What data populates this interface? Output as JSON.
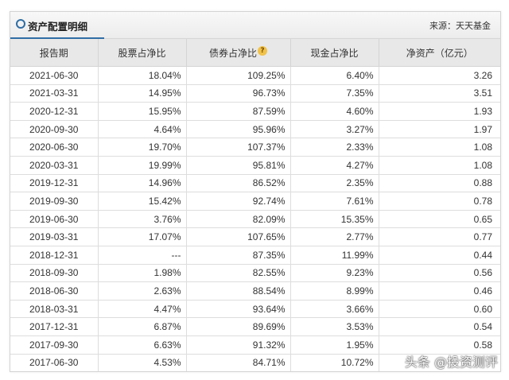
{
  "header": {
    "title": "资产配置明细",
    "source": "来源：天天基金"
  },
  "table": {
    "columns": [
      "报告期",
      "股票占净比",
      "债券占净比",
      "现金占净比",
      "净资产（亿元）"
    ],
    "help_icon": "question-icon",
    "rows": [
      [
        "2021-06-30",
        "18.04%",
        "109.25%",
        "6.40%",
        "3.26"
      ],
      [
        "2021-03-31",
        "14.95%",
        "96.73%",
        "7.35%",
        "3.51"
      ],
      [
        "2020-12-31",
        "15.95%",
        "87.59%",
        "4.60%",
        "1.93"
      ],
      [
        "2020-09-30",
        "4.64%",
        "95.96%",
        "3.27%",
        "1.97"
      ],
      [
        "2020-06-30",
        "19.70%",
        "107.37%",
        "2.33%",
        "1.08"
      ],
      [
        "2020-03-31",
        "19.99%",
        "95.81%",
        "4.27%",
        "1.08"
      ],
      [
        "2019-12-31",
        "14.96%",
        "86.52%",
        "2.35%",
        "0.88"
      ],
      [
        "2019-09-30",
        "15.42%",
        "92.74%",
        "7.61%",
        "0.78"
      ],
      [
        "2019-06-30",
        "3.76%",
        "82.09%",
        "15.35%",
        "0.65"
      ],
      [
        "2019-03-31",
        "17.07%",
        "107.65%",
        "2.77%",
        "0.77"
      ],
      [
        "2018-12-31",
        "---",
        "87.35%",
        "11.99%",
        "0.44"
      ],
      [
        "2018-09-30",
        "1.98%",
        "82.55%",
        "9.23%",
        "0.56"
      ],
      [
        "2018-06-30",
        "2.63%",
        "88.54%",
        "8.99%",
        "0.46"
      ],
      [
        "2018-03-31",
        "4.47%",
        "93.64%",
        "3.66%",
        "0.60"
      ],
      [
        "2017-12-31",
        "6.87%",
        "89.69%",
        "3.53%",
        "0.54"
      ],
      [
        "2017-09-30",
        "6.63%",
        "91.32%",
        "1.95%",
        "0.58"
      ],
      [
        "2017-06-30",
        "4.53%",
        "84.71%",
        "10.72%",
        ""
      ]
    ]
  },
  "watermark": "头条 @投资测评",
  "colors": {
    "accent": "#2f6ea5",
    "header_bg": "#e8e8e8",
    "border": "#dddddd"
  }
}
